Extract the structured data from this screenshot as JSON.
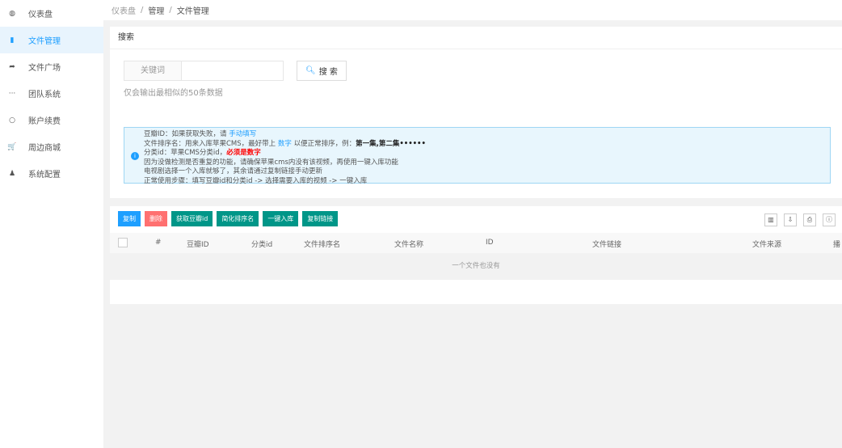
{
  "sidebar": {
    "items": [
      {
        "label": "仪表盘",
        "icon": "dashboard-icon",
        "glyph": "◍"
      },
      {
        "label": "文件管理",
        "icon": "file-icon",
        "glyph": "▮"
      },
      {
        "label": "文件广场",
        "icon": "share-icon",
        "glyph": "➦"
      },
      {
        "label": "团队系统",
        "icon": "ellipsis-icon",
        "glyph": "···"
      },
      {
        "label": "账户续费",
        "icon": "circle-icon",
        "glyph": "○"
      },
      {
        "label": "周边商城",
        "icon": "cart-icon",
        "glyph": "🛒"
      },
      {
        "label": "系统配置",
        "icon": "user-icon",
        "glyph": "♟"
      }
    ],
    "active": 1
  },
  "breadcrumb": [
    "仪表盘",
    "/",
    "管理",
    "/",
    "文件管理"
  ],
  "search": {
    "title": "搜索",
    "label": "关键词",
    "value": "",
    "button": "搜 索",
    "hint": "仅会输出最相似的50条数据"
  },
  "tip": {
    "l1a": "豆瓣ID：如果获取失败，请 ",
    "l1b": "手动填写",
    "l2a": "文件排序名：用来入库苹果CMS，最好带上 ",
    "l2b": "数字",
    "l2c": " 以便正常排序，例：",
    "l2d": "第一集,第二集••••••",
    "l3a": "分类id：苹果CMS分类id，",
    "l3b": "必须是数字",
    "l4": "因为没做检测是否重复的功能，请确保苹果cms内没有该视频，再使用一键入库功能",
    "l5": "电视剧选择一个入库就够了，其余请通过复制链接手动更新",
    "l6": "正常使用步骤：填写豆瓣id和分类id -> 选择需要入库的视频 -> 一键入库"
  },
  "toolbar": [
    {
      "label": "复制",
      "color": "#1e9fff"
    },
    {
      "label": "删除",
      "color": "#ff7070"
    },
    {
      "label": "获取豆瓣id",
      "color": "#009688"
    },
    {
      "label": "简化排序名",
      "color": "#009688"
    },
    {
      "label": "一键入库",
      "color": "#009688"
    },
    {
      "label": "复制链接",
      "color": "#009688"
    }
  ],
  "tools": [
    {
      "name": "columns-icon",
      "glyph": "▥"
    },
    {
      "name": "export-icon",
      "glyph": "⇩"
    },
    {
      "name": "print-icon",
      "glyph": "⎙"
    },
    {
      "name": "info-icon",
      "glyph": "ⓘ"
    }
  ],
  "table": {
    "columns": [
      "#",
      "豆瓣ID",
      "分类id",
      "文件排序名",
      "文件名称",
      "ID",
      "文件链接",
      "文件来源",
      "播"
    ],
    "empty": "一个文件也没有"
  }
}
